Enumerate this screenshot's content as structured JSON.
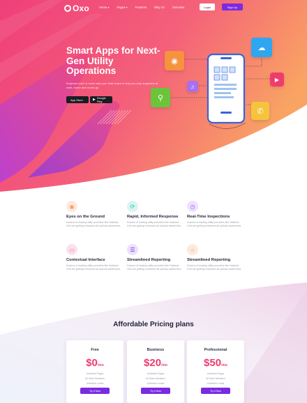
{
  "nav": {
    "logo": "Oxo",
    "menu": [
      "Home ▾",
      "Pages ▾",
      "Features",
      "Why Us",
      "Overview"
    ],
    "login": "Login",
    "signup": "Sign Up"
  },
  "hero": {
    "title": "Smart Apps for Next-Gen Utility Operations",
    "subtitle": "Empower each & every task your field crews to help you stay organized at work, home and on the go.",
    "app_store": "App Store",
    "google_play": "Google Play"
  },
  "features": [
    {
      "title": "Eyes on the Ground",
      "desc": "Dozens of leading utility providers like National Grid are getting enhanced all optimal awareness.",
      "icon": "eye-icon",
      "color": "#f39a5a",
      "bg": "#fde9dc"
    },
    {
      "title": "Rapid, Informed Response",
      "desc": "Dozens of leading utility providers like National Grid are getting enhanced all optimal awareness.",
      "icon": "refresh-icon",
      "color": "#1fc3b5",
      "bg": "#d8f5f2"
    },
    {
      "title": "Real-Time Inspections",
      "desc": "Dozens of leading utility providers like National Grid are getting enhanced all optimal awareness.",
      "icon": "clock-icon",
      "color": "#a855f7",
      "bg": "#efe1fd"
    },
    {
      "title": "Contextual Interface",
      "desc": "Dozens of leading utility providers like National Grid are getting enhanced all optimal awareness.",
      "icon": "monitor-icon",
      "color": "#e05b9c",
      "bg": "#fbe1ee"
    },
    {
      "title": "Streamlined Reporting",
      "desc": "Dozens of leading utility providers like National Grid are getting enhanced all optimal awareness.",
      "icon": "list-icon",
      "color": "#7a2be2",
      "bg": "#ece0fc"
    },
    {
      "title": "Streamlined Reporting",
      "desc": "Dozens of leading utility providers like National Grid are getting enhanced all optimal awareness.",
      "icon": "cloud-sun-icon",
      "color": "#f39a5a",
      "bg": "#fde9dc"
    }
  ],
  "pricing": {
    "title": "Affordable Pricing plans",
    "plans": [
      {
        "name": "Free",
        "price": "$0",
        "per": "/mo",
        "features": [
          "Unlimited Pages",
          "All Team Members",
          "Unlimited Leads"
        ],
        "button": "Try it Now"
      },
      {
        "name": "Business",
        "price": "$20",
        "per": "/mo",
        "features": [
          "Unlimited Pages",
          "All Team Members",
          "Unlimited Leads"
        ],
        "button": "Try it Now"
      },
      {
        "name": "Professional",
        "price": "$50",
        "per": "/mo",
        "features": [
          "Unlimited Pages",
          "All Team Members",
          "Unlimited Leads"
        ],
        "button": "Try it Now"
      }
    ]
  },
  "colors": {
    "brand": "#7a2be2",
    "hero_pink": "#ee4a7b",
    "hero_orange": "#f8a35c",
    "price": "#ef3c6f"
  }
}
